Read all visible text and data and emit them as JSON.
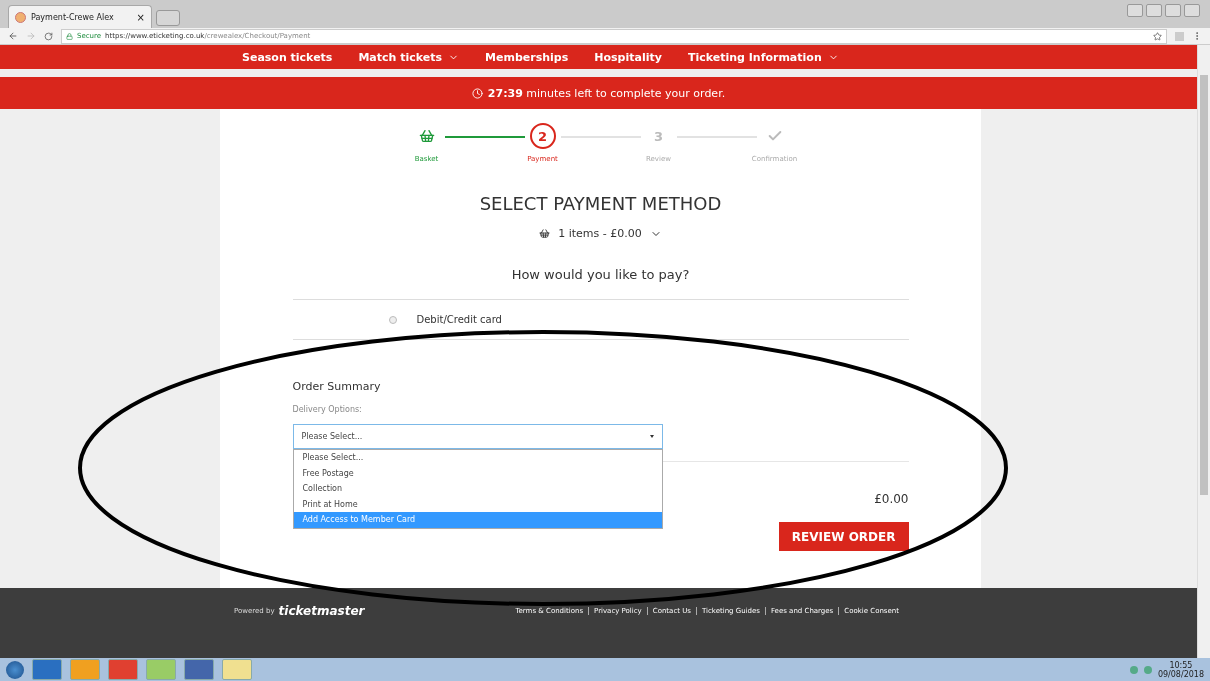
{
  "browser": {
    "tab_title": "Payment-Crewe Alex",
    "tab_close": "×",
    "secure_label": "Secure",
    "url_host": "https://www.eticketing.co.uk",
    "url_path": "/crewealex/Checkout/Payment"
  },
  "nav": [
    {
      "label": "Season tickets",
      "has_menu": false
    },
    {
      "label": "Match tickets",
      "has_menu": true
    },
    {
      "label": "Memberships",
      "has_menu": false
    },
    {
      "label": "Hospitality",
      "has_menu": false
    },
    {
      "label": "Ticketing Information",
      "has_menu": true
    }
  ],
  "timer": {
    "time": "27:39",
    "message": "minutes left to complete your order."
  },
  "steps": [
    {
      "kind": "basket",
      "label": "Basket",
      "completed": true,
      "selected": false
    },
    {
      "kind": "number",
      "marker": "2",
      "label": "Payment",
      "completed": false,
      "selected": true
    },
    {
      "kind": "number",
      "marker": "3",
      "label": "Review",
      "completed": false,
      "selected": false
    },
    {
      "kind": "check",
      "label": "Confirmation",
      "completed": false,
      "selected": false
    }
  ],
  "title": "SELECT PAYMENT METHOD",
  "basket_summary": "1 items - £0.00",
  "question": "How would you like to pay?",
  "payment_options": [
    {
      "label": "Debit/Credit card",
      "selected": false
    }
  ],
  "order_summary": {
    "heading": "Order Summary",
    "delivery_label": "Delivery Options:",
    "select_value": "Please Select...",
    "expanded": true,
    "options": [
      {
        "label": "Please Select...",
        "selected": false
      },
      {
        "label": "Free Postage",
        "selected": false
      },
      {
        "label": "Collection",
        "selected": false
      },
      {
        "label": "Print at Home",
        "selected": false
      },
      {
        "label": "Add Access to Member Card",
        "selected": true
      }
    ],
    "total": "£0.00",
    "button": "REVIEW ORDER"
  },
  "footer": {
    "powered_by": "Powered by",
    "brand": "ticketmaster",
    "links": [
      "Terms & Conditions",
      "Privacy Policy",
      "Contact Us",
      "Ticketing Guides",
      "Fees and Charges",
      "Cookie Consent"
    ]
  },
  "taskbar": {
    "time": "10:55",
    "date": "09/08/2018"
  },
  "annotation": {
    "kind": "ellipse"
  }
}
